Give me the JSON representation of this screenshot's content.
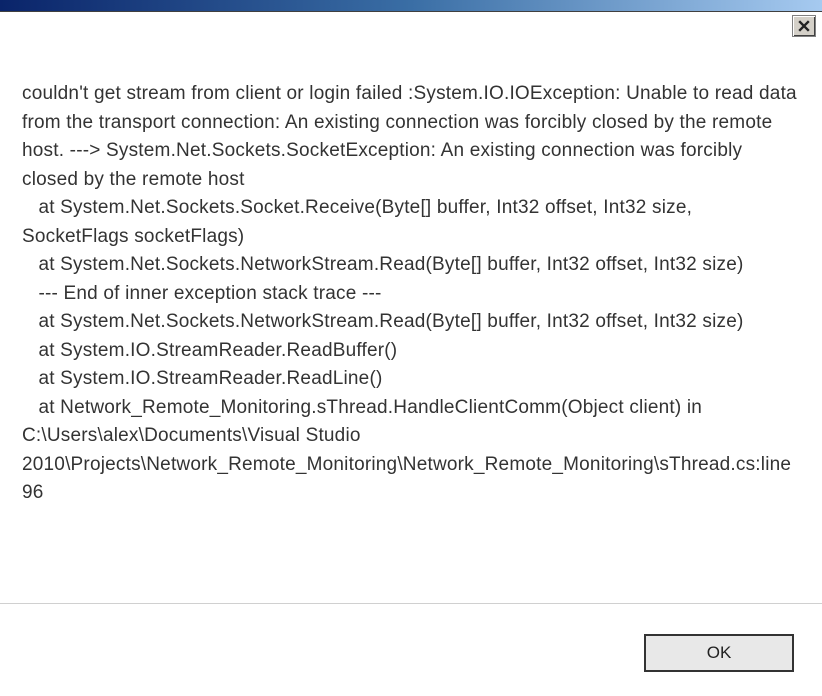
{
  "dialog": {
    "close_label": "Close",
    "message": "couldn't get stream from client or login failed :System.IO.IOException: Unable to read data from the transport connection: An existing connection was forcibly closed by the remote host. ---> System.Net.Sockets.SocketException: An existing connection was forcibly closed by the remote host\n   at System.Net.Sockets.Socket.Receive(Byte[] buffer, Int32 offset, Int32 size, SocketFlags socketFlags)\n   at System.Net.Sockets.NetworkStream.Read(Byte[] buffer, Int32 offset, Int32 size)\n   --- End of inner exception stack trace ---\n   at System.Net.Sockets.NetworkStream.Read(Byte[] buffer, Int32 offset, Int32 size)\n   at System.IO.StreamReader.ReadBuffer()\n   at System.IO.StreamReader.ReadLine()\n   at Network_Remote_Monitoring.sThread.HandleClientComm(Object client) in C:\\Users\\alex\\Documents\\Visual Studio 2010\\Projects\\Network_Remote_Monitoring\\Network_Remote_Monitoring\\sThread.cs:line 96",
    "ok_label": "OK"
  }
}
